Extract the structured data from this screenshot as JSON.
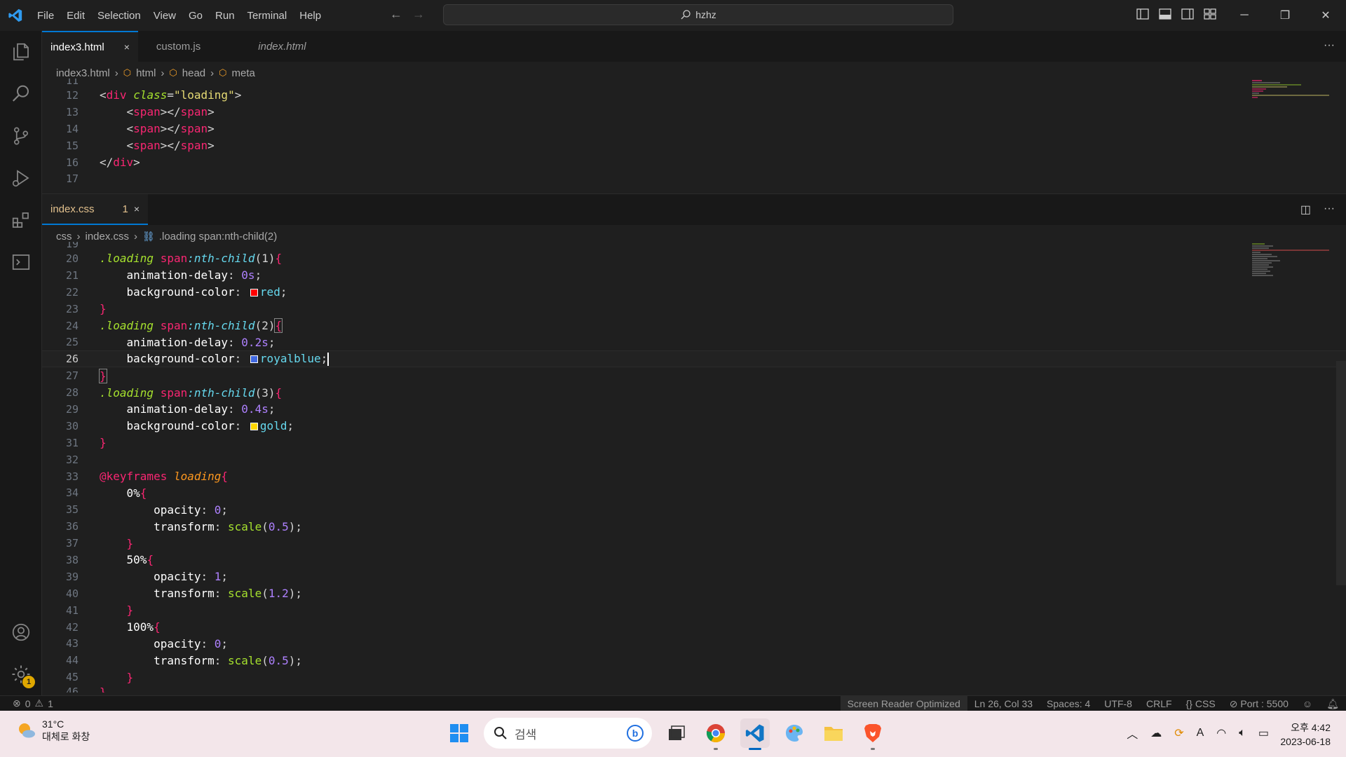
{
  "titlebar": {
    "menu": [
      "File",
      "Edit",
      "Selection",
      "View",
      "Go",
      "Run",
      "Terminal",
      "Help"
    ],
    "search_text": "hzhz"
  },
  "group1": {
    "tabs": [
      {
        "label": "index3.html",
        "active": true,
        "close": "×"
      },
      {
        "label": "custom.js",
        "active": false
      },
      {
        "label": "index.html",
        "active": false,
        "italic": true
      }
    ],
    "breadcrumb": [
      "index3.html",
      "html",
      "head",
      "meta"
    ]
  },
  "group2": {
    "tab": {
      "label": "index.css",
      "problems": "1",
      "close": "×"
    },
    "breadcrumb": [
      "css",
      "index.css",
      ".loading span:nth-child(2)"
    ]
  },
  "html_code": {
    "top_partial_line": "11",
    "lines": [
      "12",
      "13",
      "14",
      "15",
      "16",
      "17"
    ],
    "div_class_value": "\"loading\"",
    "div_attr": "class",
    "tag_div": "div",
    "tag_span": "span"
  },
  "css_code": {
    "top_partial_line": "19",
    "bottom_partial_line": "46",
    "line_numbers": [
      "20",
      "21",
      "22",
      "23",
      "24",
      "25",
      "26",
      "27",
      "28",
      "29",
      "30",
      "31",
      "32",
      "33",
      "34",
      "35",
      "36",
      "37",
      "38",
      "39",
      "40",
      "41",
      "42",
      "43",
      "44",
      "45"
    ],
    "current_line": "26",
    "selector_class": ".loading",
    "selector_tag": "span",
    "pseudo": ":nth-child",
    "nth": [
      "(1)",
      "(2)",
      "(3)"
    ],
    "prop_delay": "animation-delay",
    "prop_bg": "background-color",
    "delays": [
      "0s",
      "0.2s",
      "0.4s"
    ],
    "colors": [
      {
        "name": "red",
        "hex": "#ff0000"
      },
      {
        "name": "royalblue",
        "hex": "#4169e1"
      },
      {
        "name": "gold",
        "hex": "#ffd700"
      }
    ],
    "at_keyframes": "@keyframes",
    "keyframes_name": "loading",
    "keyframes": [
      {
        "pct": "0%",
        "opacity": "0",
        "scale": "0.5"
      },
      {
        "pct": "50%",
        "opacity": "1",
        "scale": "1.2"
      },
      {
        "pct": "100%",
        "opacity": "0",
        "scale": "0.5"
      }
    ],
    "prop_opacity": "opacity",
    "prop_transform": "transform",
    "fn_scale": "scale"
  },
  "statusbar": {
    "errors": "0",
    "warnings": "1",
    "screen_reader": "Screen Reader Optimized",
    "position": "Ln 26, Col 33",
    "spaces": "Spaces: 4",
    "encoding": "UTF-8",
    "eol": "CRLF",
    "language": "CSS",
    "port": "Port : 5500"
  },
  "activity_badge": "1",
  "taskbar": {
    "weather_temp": "31°C",
    "weather_desc": "대체로 화창",
    "search_placeholder": "검색",
    "time": "오후 4:42",
    "date": "2023-06-18"
  },
  "colors": {
    "accent": "#0078d4",
    "editor_bg": "#1f1f1f"
  }
}
